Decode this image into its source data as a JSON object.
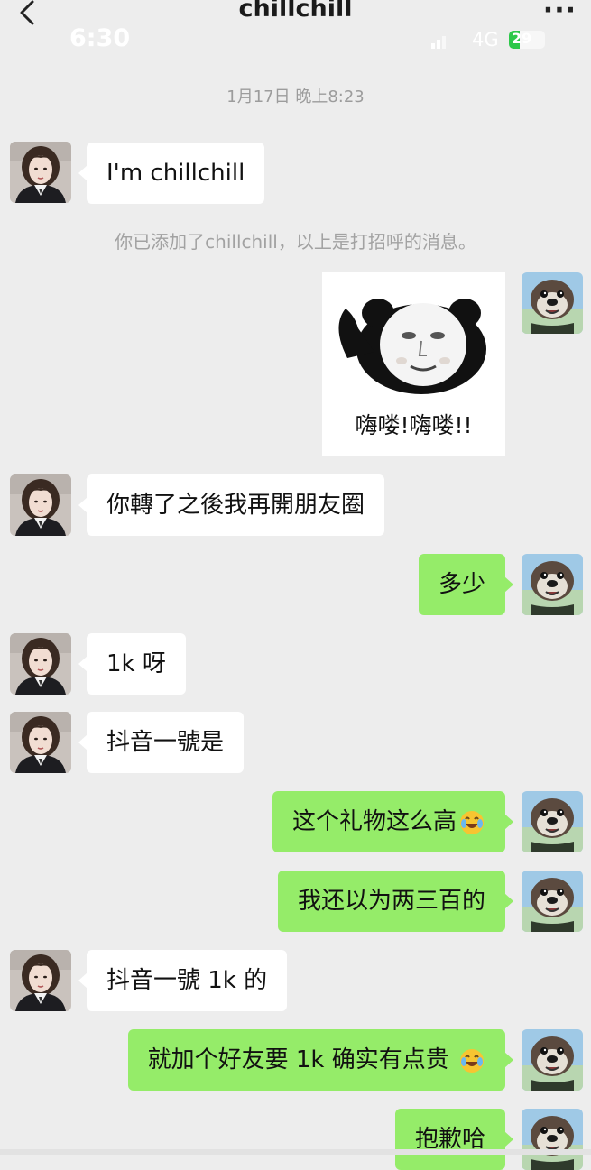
{
  "header": {
    "title": "chillchill",
    "more_label": "···"
  },
  "status_bar": {
    "time": "6:30",
    "network": "4G",
    "battery": "29",
    "battery_level": 0.29
  },
  "timestamp": "1月17日 晚上8:23",
  "system_note": "你已添加了chillchill，以上是打招呼的消息。",
  "sticker": {
    "caption": "嗨喽!嗨喽!!"
  },
  "messages": [
    {
      "text": "I'm chillchill"
    },
    {
      "text": "你轉了之後我再開朋友圈"
    },
    {
      "text": "多少"
    },
    {
      "text": "1k 呀"
    },
    {
      "text": "抖音一號是"
    },
    {
      "text": "这个礼物这么高"
    },
    {
      "text": "我还以为两三百的"
    },
    {
      "text": "抖音一號 1k 的"
    },
    {
      "text": "就加个好友要 1k  确实有点贵"
    },
    {
      "text": "抱歉哈"
    }
  ],
  "colors": {
    "background": "#ededed",
    "incoming": "#ffffff",
    "outgoing": "#95ec69",
    "battery": "#2dc84a"
  },
  "icons": [
    "back-arrow-icon",
    "more-icon",
    "signal-icon",
    "battery-icon",
    "laughing-emoji-icon"
  ]
}
